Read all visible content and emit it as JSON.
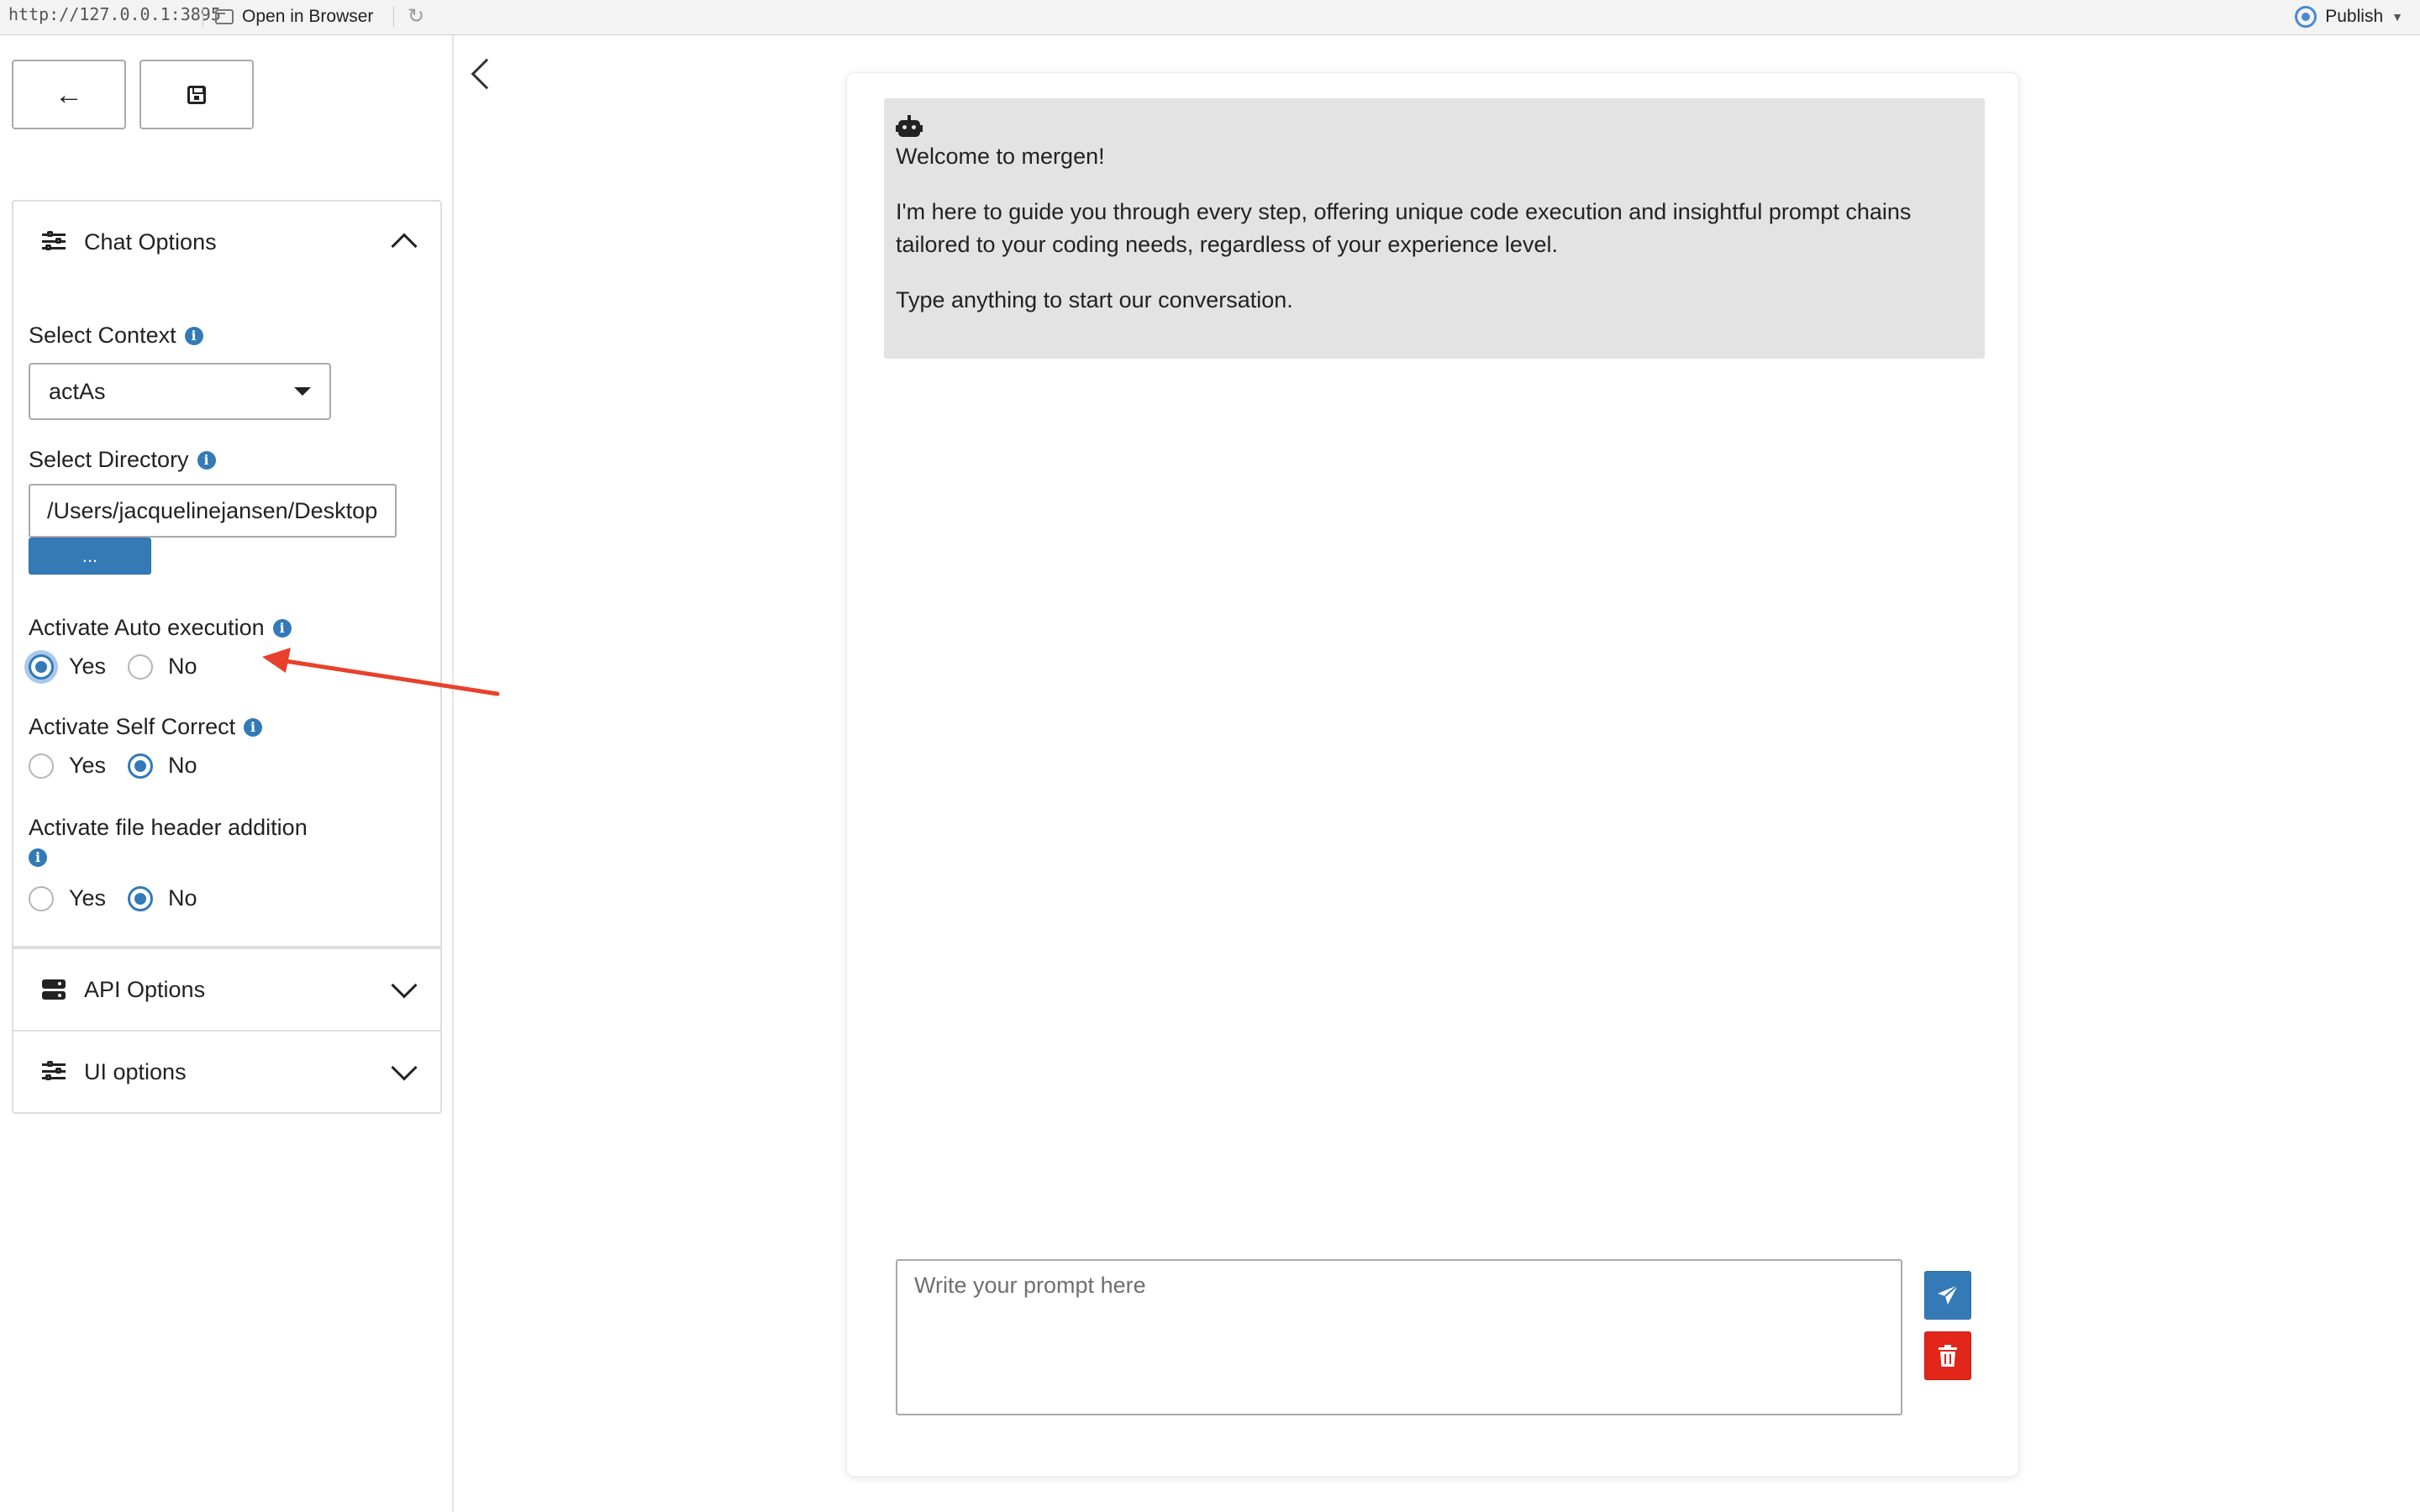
{
  "topbar": {
    "url": "http://127.0.0.1:3895",
    "open_in_browser": "Open in Browser",
    "publish": "Publish"
  },
  "sidebar": {
    "chat_options": {
      "title": "Chat Options",
      "expanded": true,
      "select_context": {
        "label": "Select Context",
        "selected": "actAs"
      },
      "select_directory": {
        "label": "Select Directory",
        "value": "/Users/jacquelinejansen/Desktop",
        "button_label": "..."
      },
      "auto_execution": {
        "label": "Activate Auto execution",
        "options": [
          "Yes",
          "No"
        ],
        "selected": "Yes"
      },
      "self_correct": {
        "label": "Activate Self Correct",
        "options": [
          "Yes",
          "No"
        ],
        "selected": "No"
      },
      "file_header": {
        "label": "Activate file header addition",
        "options": [
          "Yes",
          "No"
        ],
        "selected": "No"
      }
    },
    "api_options": {
      "title": "API Options",
      "expanded": false
    },
    "ui_options": {
      "title": "UI options",
      "expanded": false
    }
  },
  "chat": {
    "welcome_title": "Welcome to mergen!",
    "welcome_body": "I'm here to guide you through every step, offering unique code execution and insightful prompt chains tailored to your coding needs, regardless of your experience level.",
    "welcome_cta": "Type anything to start our conversation.",
    "prompt_placeholder": "Write your prompt here"
  },
  "colors": {
    "primary": "#337ab7",
    "danger": "#e2261a",
    "message_bg": "#e3e3e3",
    "annotation_arrow": "#e8412b"
  }
}
